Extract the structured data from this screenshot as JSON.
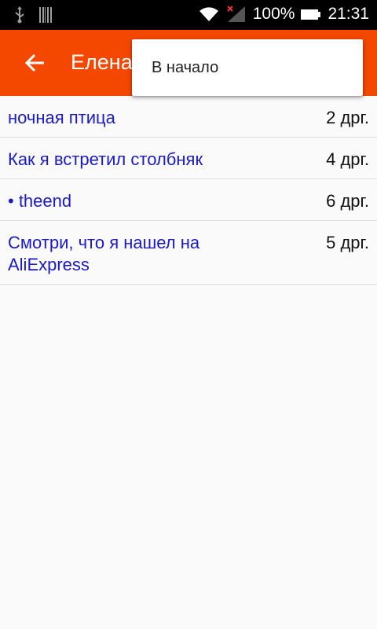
{
  "status_bar": {
    "battery": "100%",
    "time": "21:31",
    "icons": [
      "usb-icon",
      "barcode-icon",
      "wifi-icon",
      "signal-icon",
      "battery-icon"
    ]
  },
  "toolbar": {
    "title": "Елена",
    "back_icon": "arrow-back-icon",
    "color": "#f44700"
  },
  "menu": {
    "items": [
      {
        "label": "В начало"
      }
    ]
  },
  "list": {
    "items": [
      {
        "title": "ночная птица",
        "count": "2 дрг."
      },
      {
        "title": "Как я встретил столбняк",
        "count": "4 дрг."
      },
      {
        "title": "• theend",
        "count": "6 дрг."
      },
      {
        "title": "Смотри, что я нашел на AliExpress",
        "count": "5 дрг."
      }
    ]
  }
}
